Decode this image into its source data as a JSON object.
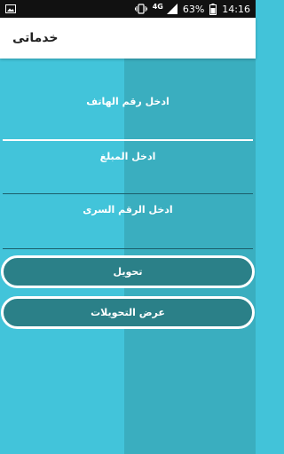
{
  "status_bar": {
    "network": "4G",
    "battery": "63%",
    "time": "14:16"
  },
  "app_bar": {
    "title": "خدماتى"
  },
  "form": {
    "phone_label": "ادخل رقم الهاتف",
    "amount_label": "ادخل المبلغ",
    "pin_label": "ادخل الرقم السرى"
  },
  "actions": {
    "transfer_label": "تحويل",
    "view_transfers_label": "عرض التحويلات"
  },
  "colors": {
    "background_left": "#42c4da",
    "background_right": "#3aaebf",
    "button_fill": "#2b8088",
    "button_border": "#ffffff"
  }
}
